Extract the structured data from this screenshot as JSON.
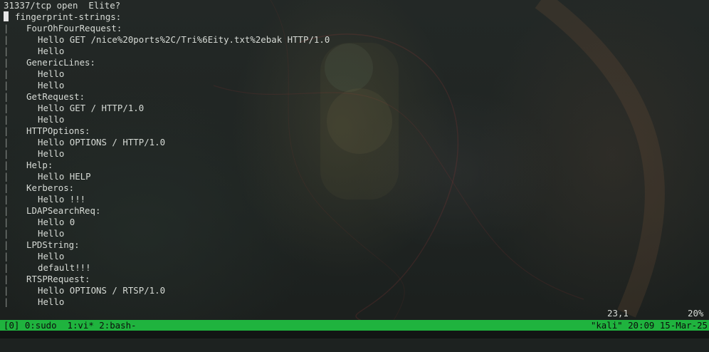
{
  "terminal": {
    "header_line": "31337/tcp open  Elite?",
    "lines": [
      {
        "gutter": "",
        "text": "fingerprint-strings:",
        "indent": 1,
        "cursor": true
      },
      {
        "gutter": "|",
        "text": "FourOhFourRequest:",
        "indent": 2
      },
      {
        "gutter": "|",
        "text": "Hello GET /nice%20ports%2C/Tri%6Eity.txt%2ebak HTTP/1.0",
        "indent": 3
      },
      {
        "gutter": "|",
        "text": "Hello",
        "indent": 3
      },
      {
        "gutter": "|",
        "text": "GenericLines:",
        "indent": 2
      },
      {
        "gutter": "|",
        "text": "Hello",
        "indent": 3
      },
      {
        "gutter": "|",
        "text": "Hello",
        "indent": 3
      },
      {
        "gutter": "|",
        "text": "GetRequest:",
        "indent": 2
      },
      {
        "gutter": "|",
        "text": "Hello GET / HTTP/1.0",
        "indent": 3
      },
      {
        "gutter": "|",
        "text": "Hello",
        "indent": 3
      },
      {
        "gutter": "|",
        "text": "HTTPOptions:",
        "indent": 2
      },
      {
        "gutter": "|",
        "text": "Hello OPTIONS / HTTP/1.0",
        "indent": 3
      },
      {
        "gutter": "|",
        "text": "Hello",
        "indent": 3
      },
      {
        "gutter": "|",
        "text": "Help:",
        "indent": 2
      },
      {
        "gutter": "|",
        "text": "Hello HELP",
        "indent": 3
      },
      {
        "gutter": "|",
        "text": "Kerberos:",
        "indent": 2
      },
      {
        "gutter": "|",
        "text": "Hello !!!",
        "indent": 3
      },
      {
        "gutter": "|",
        "text": "LDAPSearchReq:",
        "indent": 2
      },
      {
        "gutter": "|",
        "text": "Hello 0",
        "indent": 3
      },
      {
        "gutter": "|",
        "text": "Hello",
        "indent": 3
      },
      {
        "gutter": "|",
        "text": "LPDString:",
        "indent": 2
      },
      {
        "gutter": "|",
        "text": "Hello",
        "indent": 3
      },
      {
        "gutter": "|",
        "text": "default!!!",
        "indent": 3
      },
      {
        "gutter": "|",
        "text": "RTSPRequest:",
        "indent": 2
      },
      {
        "gutter": "|",
        "text": "Hello OPTIONS / RTSP/1.0",
        "indent": 3
      },
      {
        "gutter": "|",
        "text": "Hello",
        "indent": 3
      }
    ]
  },
  "vim_status": {
    "position": "23,1",
    "percent": "20%"
  },
  "tmux": {
    "left": "[0] 0:sudo  1:vi* 2:bash-",
    "right": "\"kali\" 20:09 15-Mar-25",
    "bar_color": "#1fb33e"
  }
}
